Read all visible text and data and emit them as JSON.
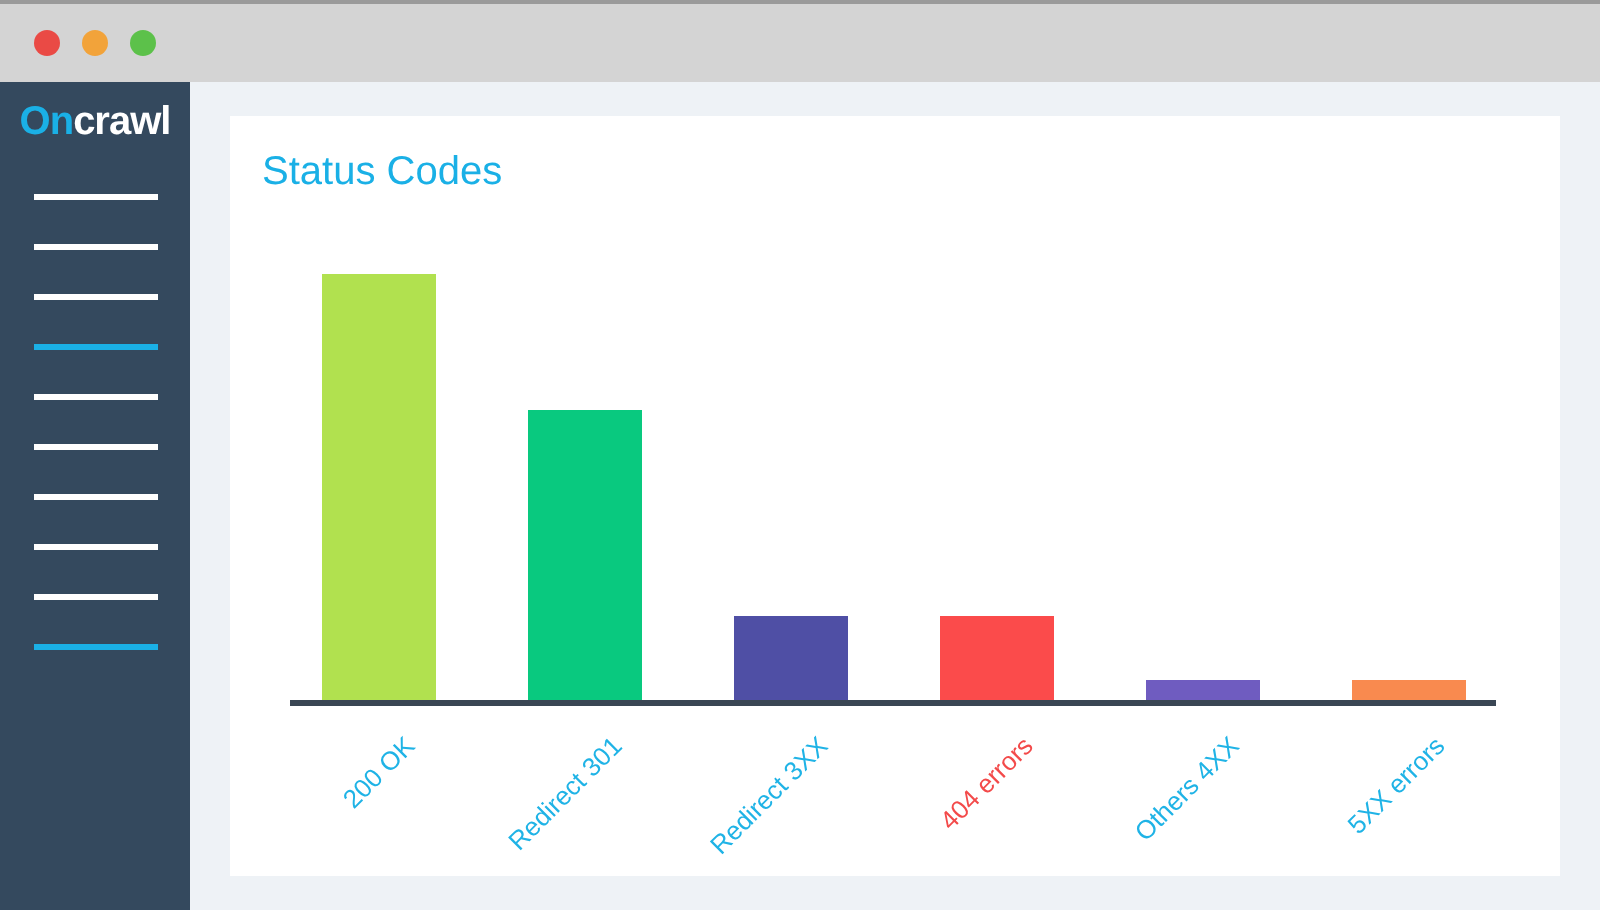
{
  "window": {
    "controls": [
      {
        "color": "#ea4a45"
      },
      {
        "color": "#f2a33a"
      },
      {
        "color": "#5cc14a"
      }
    ]
  },
  "logo": {
    "accent": "On",
    "rest": "crawl"
  },
  "sidebar": {
    "items": [
      {
        "selected": false
      },
      {
        "selected": false
      },
      {
        "selected": false
      },
      {
        "selected": true
      },
      {
        "selected": false
      },
      {
        "selected": false
      },
      {
        "selected": false
      },
      {
        "selected": false
      },
      {
        "selected": false
      },
      {
        "selected": true
      }
    ]
  },
  "card": {
    "title": "Status Codes",
    "bars": [
      {
        "label": "200 OK",
        "color": "#b1e14f",
        "alert": false
      },
      {
        "label": "Redirect 301",
        "color": "#09c97f",
        "alert": false
      },
      {
        "label": "Redirect 3XX",
        "color": "#4f4fa5",
        "alert": false
      },
      {
        "label": "404 errors",
        "color": "#fb4b4b",
        "alert": true
      },
      {
        "label": "Others 4XX",
        "color": "#6f5cc0",
        "alert": false
      },
      {
        "label": "5XX errors",
        "color": "#f98a4f",
        "alert": false
      }
    ]
  }
}
